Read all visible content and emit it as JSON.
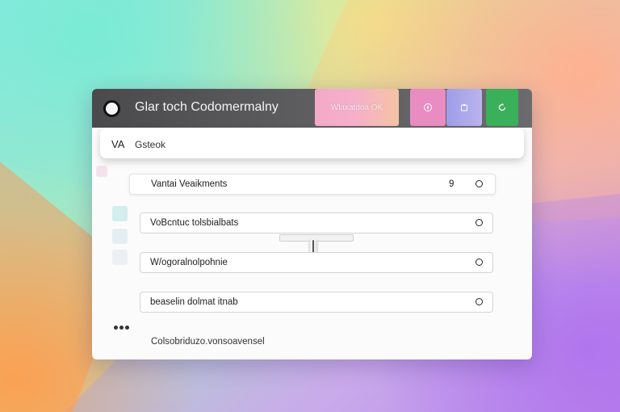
{
  "app": {
    "title": "Glar toch Codomermalny"
  },
  "tabs": [
    {
      "label": "Wlaxatdoa OK",
      "color": "#f3a9c8",
      "icon": null
    },
    {
      "label": "",
      "color": "#e98cc2",
      "icon": "compass-icon"
    },
    {
      "label": "",
      "color": "#a8a5ea",
      "icon": "puzzle-icon"
    },
    {
      "label": "",
      "color": "#3bb05a",
      "icon": "refresh-icon"
    }
  ],
  "address_bar": {
    "prefix": "VA",
    "value": "Gsteok"
  },
  "settings": [
    {
      "label": "Vantai Veaikments",
      "value": "9",
      "selected": false
    },
    {
      "label": "VoBcntuc tolsbialbats",
      "value": "",
      "selected": false
    },
    {
      "label": "W/ogoralnolpohnie",
      "value": "",
      "selected": false
    },
    {
      "label": "beaselin dolmat itnab",
      "value": "",
      "selected": false
    }
  ],
  "slider": {
    "level": 0.4
  },
  "footer": {
    "text": "Colsobriduzo.vonsoavensel"
  }
}
